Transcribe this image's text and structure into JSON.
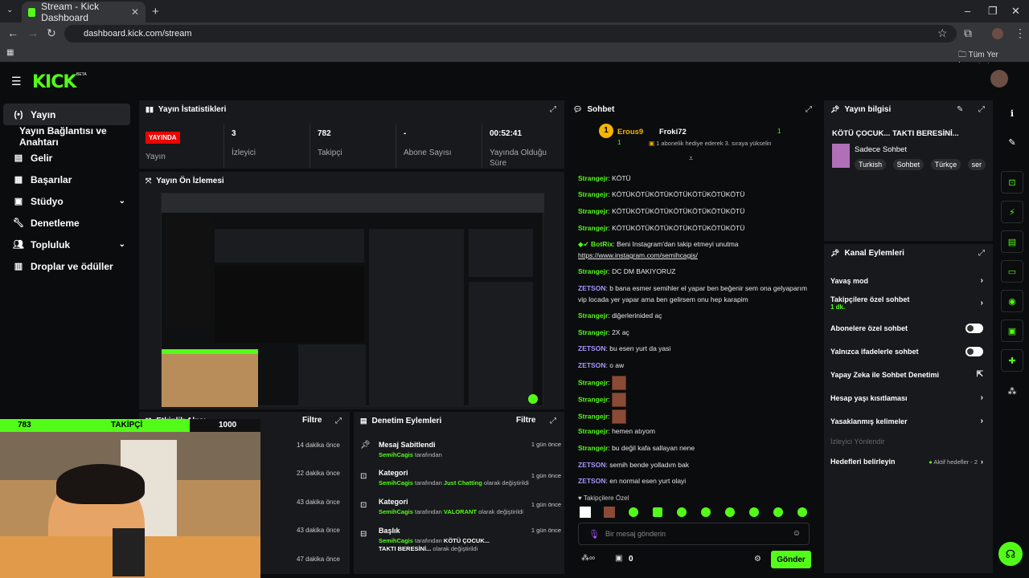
{
  "browser": {
    "tab_title": "Stream - Kick Dashboard",
    "url": "dashboard.kick.com/stream",
    "bookmarks_label": "Tüm Yer İşaretleri"
  },
  "header": {
    "logo": "KICK",
    "beta": "BETA"
  },
  "sidebar": {
    "items": [
      {
        "label": "Yayın",
        "icon": "broadcast-icon"
      },
      {
        "label": "Yayın Bağlantısı ve Anahtarı",
        "icon": ""
      },
      {
        "label": "Gelir",
        "icon": "revenue-icon"
      },
      {
        "label": "Başarılar",
        "icon": "achievements-icon"
      },
      {
        "label": "Stüdyo",
        "icon": "studio-icon"
      },
      {
        "label": "Denetleme",
        "icon": "wrench-icon"
      },
      {
        "label": "Topluluk",
        "icon": "community-icon"
      },
      {
        "label": "Droplar ve ödüller",
        "icon": "gift-icon"
      }
    ]
  },
  "stats": {
    "title": "Yayın İstatistikleri",
    "live_badge": "YAYINDA",
    "live_label": "Yayın",
    "viewers_value": "3",
    "viewers_label": "İzleyici",
    "followers_value": "782",
    "followers_label": "Takipçi",
    "subs_value": "-",
    "subs_label": "Abone Sayısı",
    "uptime_value": "00:52:41",
    "uptime_label": "Yayında Olduğu Süre"
  },
  "preview": {
    "title": "Yayın Ön İzlemesi"
  },
  "activity": {
    "title": "Etkinlik Akışı",
    "filter": "Filtre",
    "times": [
      "14 dakika önce",
      "22 dakika önce",
      "43 dakika önce",
      "43 dakika önce",
      "47 dakika önce"
    ]
  },
  "overlay": {
    "count": "783",
    "label": "TAKİPÇİ",
    "goal": "1000"
  },
  "moderation": {
    "title": "Denetim Eylemleri",
    "filter": "Filtre",
    "items": [
      {
        "title": "Mesaj Sabitlendi",
        "user": "SemihCagis",
        "text": "tarafından",
        "time": "1 gün önce"
      },
      {
        "title": "Kategori",
        "user": "SemihCagis",
        "text": "tarafından",
        "hl": "Just Chatting",
        "tail": "olarak değiştirildi",
        "time": "1 gün önce"
      },
      {
        "title": "Kategori",
        "user": "SemihCagis",
        "text": "tarafından",
        "hl": "VALORANT",
        "tail": "olarak değiştirildi",
        "time": "1 gün önce"
      },
      {
        "title": "Başlık",
        "user": "SemihCagis",
        "text": "tarafından",
        "hl": "KÖTÜ ÇOCUK... TAKTI BERESİNİ...",
        "tail": "olarak değiştirildi",
        "time": "1 gün önce"
      }
    ]
  },
  "chat": {
    "title": "Sohbet",
    "gift_user1": "Erous9",
    "gift_count1": "1",
    "gift_user2": "Froki72",
    "gift_count2": "1",
    "gift_text": "1 abonelik hediye ederek 3. sıraya yükselin",
    "messages": [
      {
        "user": "Strangejr",
        "text": "KÖTÜ",
        "color": "g"
      },
      {
        "user": "Strangejr",
        "text": "KÖTÜKÖTÜKÖTÜKÖTÜKÖTÜKÖTÜKÖTÜ",
        "color": "g"
      },
      {
        "user": "Strangejr",
        "text": "KÖTÜKÖTÜKÖTÜKÖTÜKÖTÜKÖTÜKÖTÜ",
        "color": "g"
      },
      {
        "user": "Strangejr",
        "text": "KÖTÜKÖTÜKÖTÜKÖTÜKÖTÜKÖTÜKÖTÜ",
        "color": "g"
      },
      {
        "user": "BotRix",
        "text": "Beni Instagram'dan takip etmeyi unutma",
        "link": "https://www.instagram.com/semihcagis/",
        "color": "g"
      },
      {
        "user": "Strangejr",
        "text": "DC DM BAKIYORUZ",
        "color": "g"
      },
      {
        "user": "ZETSON",
        "text": "b bana esmer semihler el yapar ben beğenir sem ona gelyaparım vip locada yer yapar ama ben gelirsem onu hep karapim",
        "color": "p"
      },
      {
        "user": "Strangejr",
        "text": "diğerlerinided aç",
        "color": "g"
      },
      {
        "user": "Strangejr",
        "text": "2X aç",
        "color": "g"
      },
      {
        "user": "ZETSON",
        "text": "bu esen yurt da yasi",
        "color": "p"
      },
      {
        "user": "ZETSON",
        "text": "o aw",
        "color": "p"
      },
      {
        "user": "Strangejr",
        "text": "",
        "color": "g"
      },
      {
        "user": "Strangejr",
        "text": "",
        "color": "g"
      },
      {
        "user": "Strangejr",
        "text": "",
        "color": "g"
      },
      {
        "user": "Strangejr",
        "text": "hemen atıyom",
        "color": "g"
      },
      {
        "user": "Strangejr",
        "text": "bu değil kafa sallayan nene",
        "color": "g"
      },
      {
        "user": "ZETSON",
        "text": "semih bende yolladım bak",
        "color": "p"
      },
      {
        "user": "ZETSON",
        "text": "en normal esen yurt olayi",
        "color": "p"
      }
    ],
    "followers_only": "Takipçilere Özel",
    "input_placeholder": "Bir mesaj gönderin",
    "points": "0",
    "send": "Gönder"
  },
  "stream_info": {
    "title": "Yayın bilgisi",
    "stream_title": "KÖTÜ ÇOCUK... TAKTI BERESİNİ...",
    "category": "Sadece Sohbet",
    "tags": [
      "Turkish",
      "Sohbet",
      "Türkçe",
      "ser"
    ]
  },
  "channel_actions": {
    "title": "Kanal Eylemleri",
    "slow_mode": "Yavaş mod",
    "followers_chat": "Takipçilere özel sohbet",
    "followers_chat_sub": "1 dk.",
    "subs_chat": "Abonelere özel sohbet",
    "emote_chat": "Yalnızca ifadelerle sohbet",
    "ai_mod": "Yapay Zeka ile Sohbet Denetimi",
    "age_limit": "Hesap yaşı kısıtlaması",
    "banned_words": "Yasaklanmış kelimeler",
    "redirect": "İzleyici Yönlendir",
    "goals": "Hedefleri belirleyin",
    "goals_status": "Aktif hedefler - 2"
  },
  "colors": {
    "accent": "#53fc18",
    "live": "#eb0400",
    "panel": "#18191c"
  }
}
